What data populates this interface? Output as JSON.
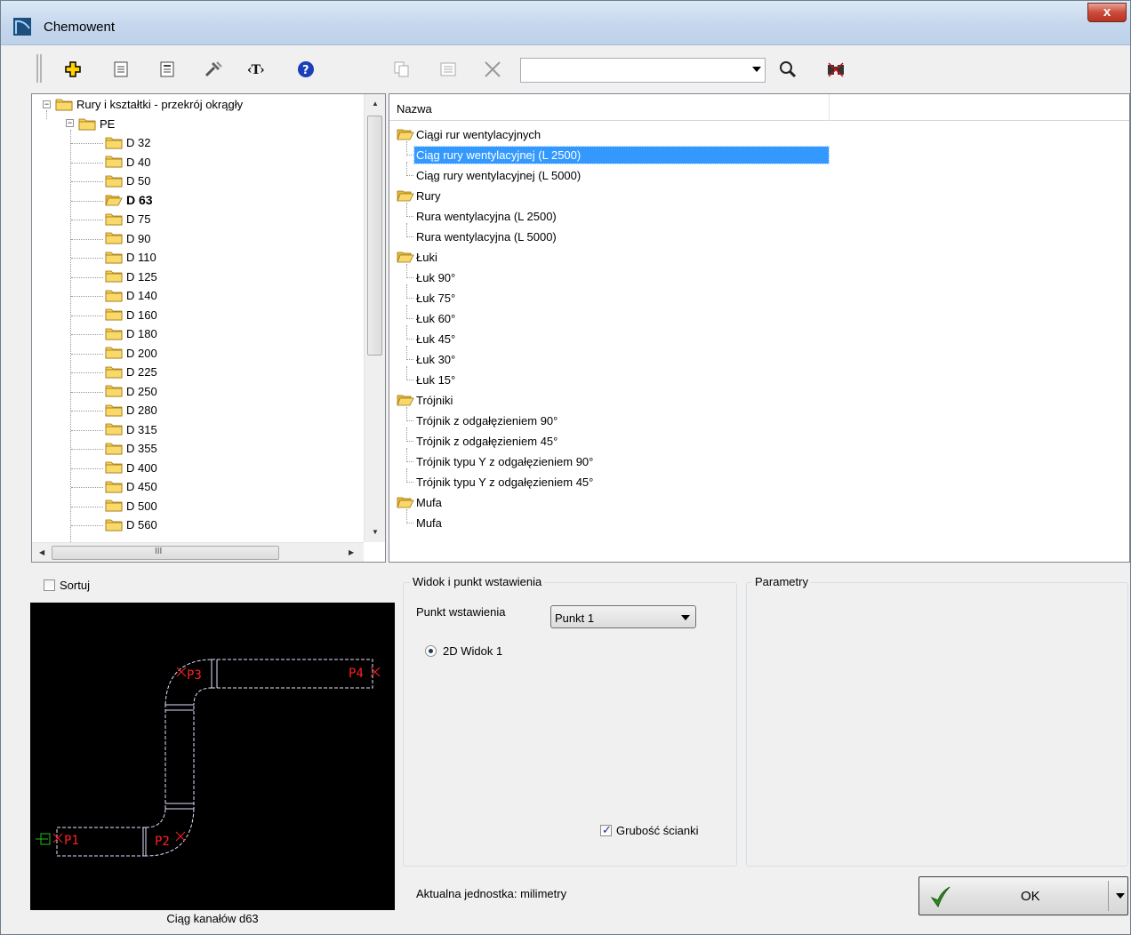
{
  "window": {
    "title": "Chemowent",
    "close_label": "x"
  },
  "toolbar": {
    "search_value": ""
  },
  "tree": {
    "root": "Rury i kształtki - przekrój okrągły",
    "group": "PE",
    "items": [
      "D 32",
      "D 40",
      "D 50",
      "D 63",
      "D 75",
      "D 90",
      "D 110",
      "D 125",
      "D 140",
      "D 160",
      "D 180",
      "D 200",
      "D 225",
      "D 250",
      "D 280",
      "D 315",
      "D 355",
      "D 400",
      "D 450",
      "D 500",
      "D 560"
    ],
    "selected": "D 63",
    "hscroll_glyph": "III"
  },
  "list": {
    "column_header": "Nazwa",
    "rows": [
      {
        "label": "Ciągi rur wentylacyjnych",
        "folder": true
      },
      {
        "label": "Ciąg rury wentylacyjnej (L 2500)",
        "folder": false,
        "selected": true
      },
      {
        "label": "Ciąg rury wentylacyjnej (L 5000)",
        "folder": false
      },
      {
        "label": "Rury",
        "folder": true
      },
      {
        "label": "Rura wentylacyjna (L 2500)",
        "folder": false
      },
      {
        "label": "Rura wentylacyjna (L 5000)",
        "folder": false
      },
      {
        "label": "Łuki",
        "folder": true
      },
      {
        "label": "Łuk 90°",
        "folder": false
      },
      {
        "label": "Łuk 75°",
        "folder": false
      },
      {
        "label": "Łuk 60°",
        "folder": false
      },
      {
        "label": "Łuk 45°",
        "folder": false
      },
      {
        "label": "Łuk 30°",
        "folder": false
      },
      {
        "label": "Łuk 15°",
        "folder": false
      },
      {
        "label": "Trójniki",
        "folder": true
      },
      {
        "label": "Trójnik z odgałęzieniem 90°",
        "folder": false
      },
      {
        "label": "Trójnik z odgałęzieniem 45°",
        "folder": false
      },
      {
        "label": "Trójnik typu Y z odgałęzieniem 90°",
        "folder": false
      },
      {
        "label": "Trójnik typu Y z odgałęzieniem 45°",
        "folder": false
      },
      {
        "label": "Mufa",
        "folder": true
      },
      {
        "label": "Mufa",
        "folder": false
      }
    ]
  },
  "sort": {
    "label": "Sortuj",
    "checked": false
  },
  "preview": {
    "caption": "Ciąg kanałów d63",
    "points": [
      "P1",
      "P2",
      "P3",
      "P4"
    ],
    "line_color": "#e0e0ff",
    "point_color": "#ff2020"
  },
  "view_group": {
    "title": "Widok i punkt wstawienia",
    "insert_point_label": "Punkt wstawienia",
    "insert_point_value": "Punkt 1",
    "view_option": "2D Widok 1",
    "wall_thickness_label": "Grubość ścianki",
    "wall_thickness_checked": true
  },
  "params_group": {
    "title": "Parametry"
  },
  "footer": {
    "unit_text": "Aktualna jednostka: milimetry",
    "ok_label": "OK",
    "ok_check_color": "#2e8b1e"
  }
}
